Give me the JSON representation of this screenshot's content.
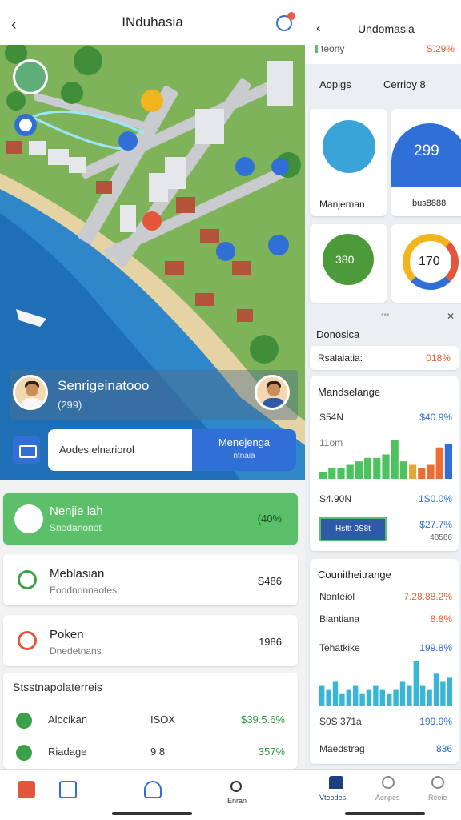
{
  "left": {
    "header": {
      "title": "INduhasia"
    },
    "profile": {
      "name": "Senrigeinatooo",
      "sub": "(299)"
    },
    "action": {
      "address": "Aodes elnariorol",
      "button_label": "Menejenga",
      "button_sub": "ntnaia"
    },
    "cards": [
      {
        "title": "Nenjie lah",
        "sub": "Snodanonot",
        "value": "(40%"
      },
      {
        "title": "Meblasian",
        "sub": "Eoodnonnaotes",
        "value": "S486"
      },
      {
        "title": "Poken",
        "sub": "Dnedetnans",
        "value": "1986"
      }
    ],
    "section": {
      "title": "Stsstnapolaterreis",
      "rows": [
        {
          "name": "Alocikan",
          "mid": "ISOX",
          "pct": "$39.5.6%"
        },
        {
          "name": "Riadage",
          "mid": "9 8",
          "pct": "357%"
        }
      ]
    },
    "nav": {
      "last_label": "Enran"
    },
    "colors": {
      "accent": "#2f6fd6",
      "green": "#5cbf6a"
    }
  },
  "right": {
    "header": {
      "title": "Undomasia",
      "sub": "teony",
      "sub_value": "S.29%"
    },
    "filter": {
      "a": "Aopigs",
      "b": "Cerrioy 8"
    },
    "tiles": [
      {
        "label": "Manjernan",
        "type": "badge"
      },
      {
        "label": "bus8888",
        "value": "299",
        "type": "blob"
      },
      {
        "value": "380",
        "type": "globe"
      },
      {
        "value": "170",
        "type": "ring"
      }
    ],
    "donut_card": {
      "title": "Donosica",
      "key": "Rsalaiatia:",
      "val": "018%"
    },
    "chart_card_1": {
      "title": "Mandselange",
      "k1": "S54N",
      "v1": "$40.9%",
      "k2": "11om",
      "k3": "S4.90N",
      "v3": "1S0.0%",
      "btn": "Hsttt 0S8t",
      "v4": "$27.7%",
      "v5": "48586",
      "chart_data": {
        "type": "bar",
        "values": [
          2,
          3,
          3,
          4,
          5,
          6,
          6,
          7,
          11,
          5,
          4,
          3,
          4,
          9,
          10
        ],
        "colors": [
          "#4cc35c",
          "#4cc35c",
          "#4cc35c",
          "#4cc35c",
          "#4cc35c",
          "#4cc35c",
          "#4cc35c",
          "#4cc35c",
          "#4cc35c",
          "#4cc35c",
          "#e2a83a",
          "#ef6b34",
          "#ef6b34",
          "#ef6b34",
          "#2f6fd6"
        ]
      }
    },
    "chart_card_2": {
      "title": "Counitheitrange",
      "rows": [
        {
          "k": "Nanteiol",
          "v": "7.28.88.2%",
          "c": "#e0623a"
        },
        {
          "k": "Blantiana",
          "v": "8.8%",
          "c": "#e0623a"
        },
        {
          "k": "Tehatkike",
          "v": "199.8%",
          "c": "#2f6fd6"
        },
        {
          "k": "S0S 371a",
          "v": "199.9%",
          "c": "#2f6fd6"
        },
        {
          "k": "Maedstrag",
          "v": "836",
          "c": "#2f6fd6"
        }
      ],
      "chart_data": {
        "type": "bar",
        "values": [
          5,
          4,
          6,
          3,
          4,
          5,
          3,
          4,
          5,
          4,
          3,
          4,
          6,
          5,
          11,
          5,
          4,
          8,
          6,
          7
        ]
      }
    },
    "nav": {
      "labels": [
        "Vteodes",
        "Aenpes",
        "Reeie"
      ]
    }
  }
}
